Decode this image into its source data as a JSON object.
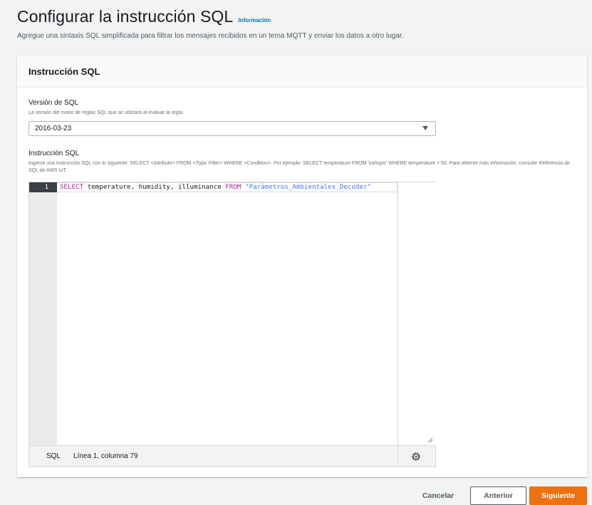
{
  "page": {
    "title": "Configurar la instrucción SQL",
    "info_link": "Información",
    "description": "Agregue una sintaxis SQL simplificada para filtrar los mensajes recibidos en un tema MQTT y enviar los datos a otro lugar."
  },
  "section": {
    "title": "Instrucción SQL"
  },
  "sql_version": {
    "label": "Versión de SQL",
    "description": "La versión del motor de reglas SQL que se utilizará al evaluar la regla.",
    "selected": "2016-03-23"
  },
  "sql_statement": {
    "label": "Instrucción SQL",
    "description": "Ingrese una instrucción SQL con lo siguiente: SELECT <Attribute> FROM <Topic Filter> WHERE <Condition>. Por ejemplo: SELECT temperature FROM 'iot/topic' WHERE temperature > 50. Para obtener más información, consulte Referencia de SQL de AWS IoT.",
    "line_number": "1",
    "code_kw_select": "SELECT",
    "code_fields": " temperature, humidity, illuminance ",
    "code_kw_from": "FROM",
    "code_space": " ",
    "code_topic": "\"Parámetros_Ambientales_Decoder\""
  },
  "status_bar": {
    "language": "SQL",
    "position": "Línea 1, columna 79"
  },
  "actions": {
    "cancel": "Cancelar",
    "previous": "Anterior",
    "next": "Siguiente"
  },
  "colors": {
    "primary_button": "#ec7211",
    "link": "#0073bb",
    "keyword": "#a626a4",
    "string": "#4078f2"
  }
}
